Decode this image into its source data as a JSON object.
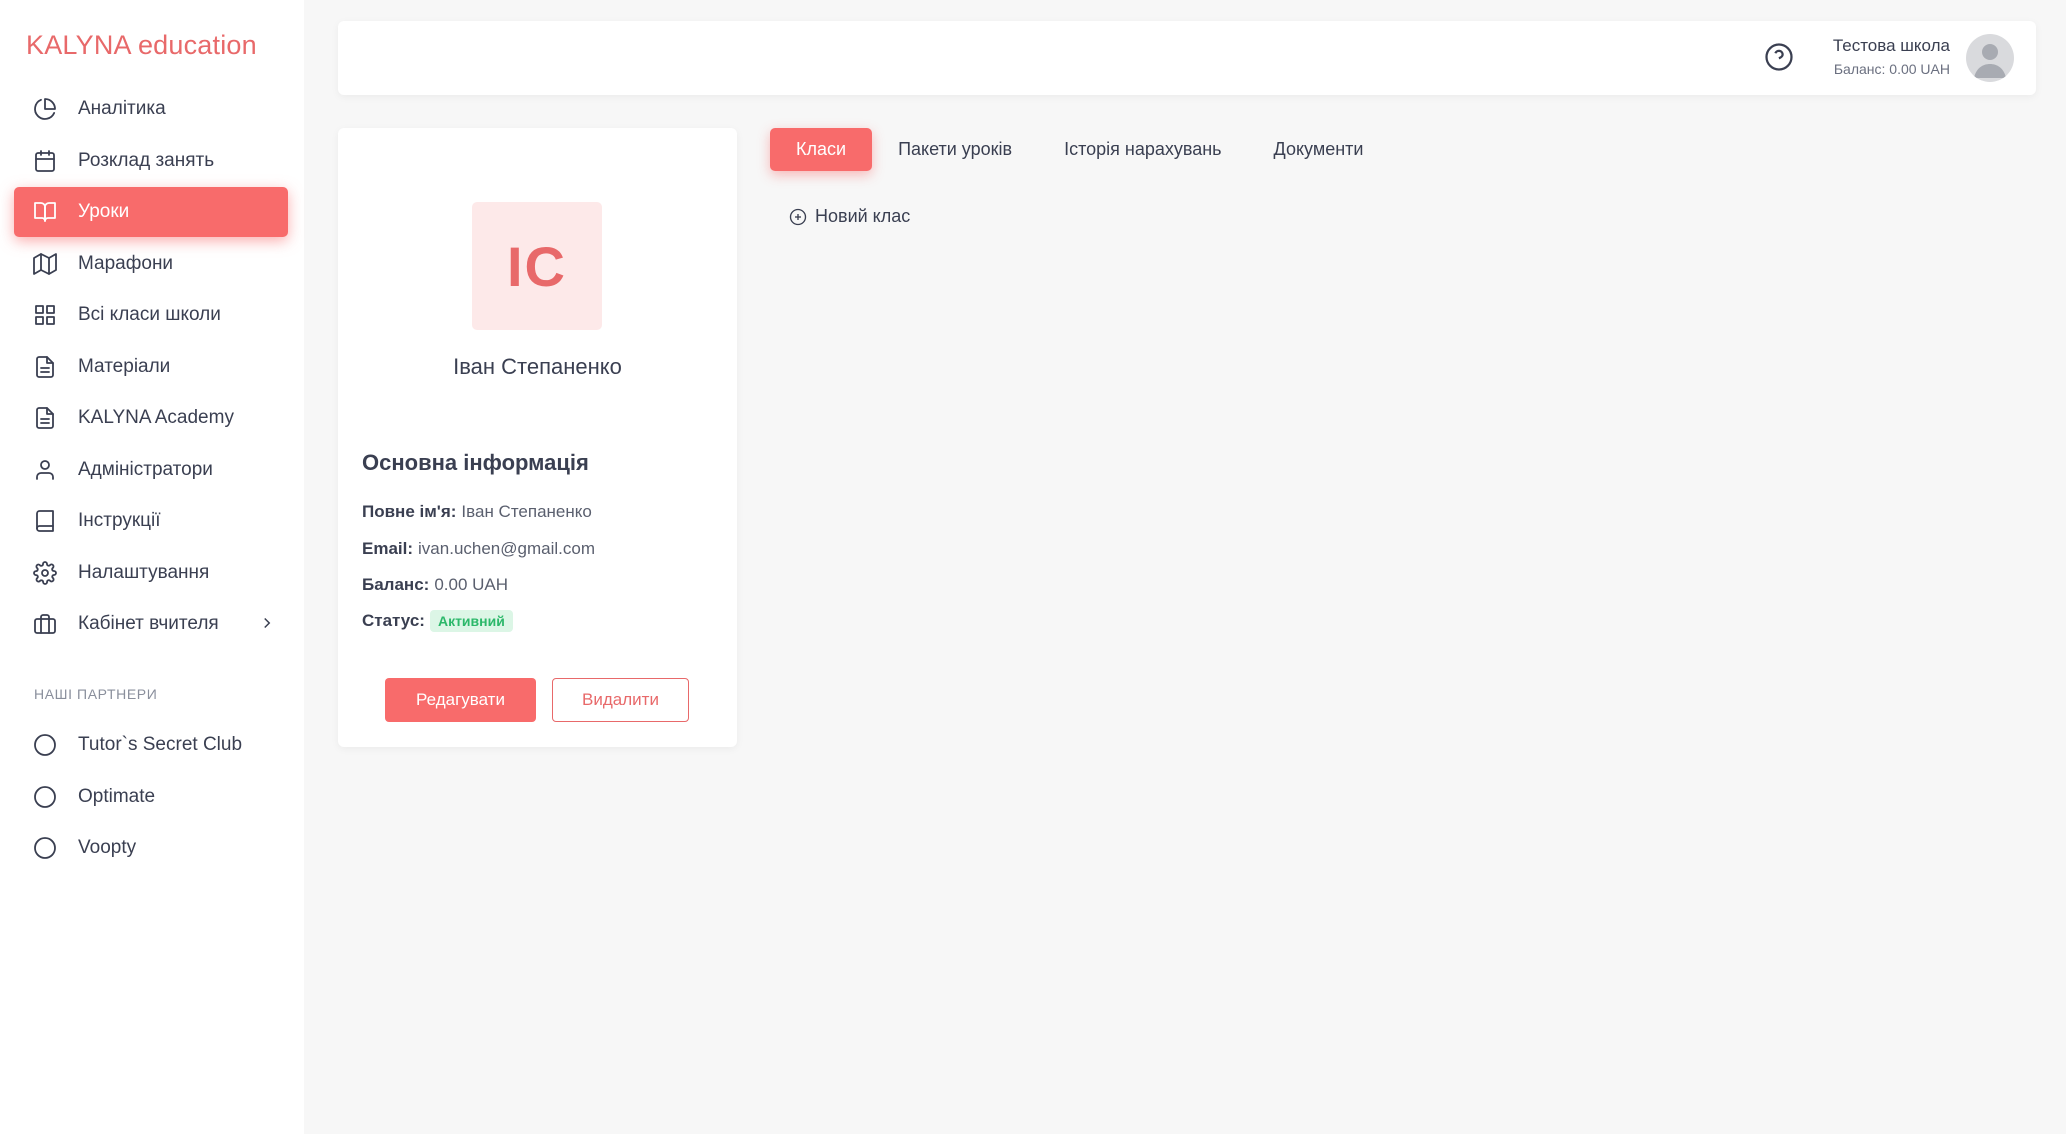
{
  "brand": {
    "logo_text": "KALYNA education",
    "accent_color": "#f86b6b"
  },
  "sidebar": {
    "items": [
      {
        "label": "Аналітика",
        "icon": "pie-chart-icon"
      },
      {
        "label": "Розклад занять",
        "icon": "calendar-icon"
      },
      {
        "label": "Уроки",
        "icon": "book-open-icon",
        "active": true
      },
      {
        "label": "Марафони",
        "icon": "map-icon"
      },
      {
        "label": "Всі класи школи",
        "icon": "grid-icon"
      },
      {
        "label": "Матеріали",
        "icon": "document-icon"
      },
      {
        "label": "KALYNA Academy",
        "icon": "document-icon"
      },
      {
        "label": "Адміністратори",
        "icon": "user-icon"
      },
      {
        "label": "Інструкції",
        "icon": "book-icon"
      },
      {
        "label": "Налаштування",
        "icon": "gear-icon"
      },
      {
        "label": "Кабінет вчителя",
        "icon": "briefcase-icon",
        "has_submenu": true
      }
    ],
    "partners_title": "НАШІ ПАРТНЕРИ",
    "partners": [
      {
        "label": "Tutor`s Secret Club",
        "icon": "circle-icon"
      },
      {
        "label": "Optimate",
        "icon": "circle-icon"
      },
      {
        "label": "Voopty",
        "icon": "circle-icon"
      }
    ]
  },
  "header": {
    "help_icon": "question-circle-icon",
    "school_name": "Тестова школа",
    "balance": "Баланс: 0.00 UAH",
    "avatar_icon": "user-avatar-icon"
  },
  "profile": {
    "initials": "ІС",
    "name": "Іван Степаненко",
    "info_title": "Основна інформація",
    "full_name_label": "Повне ім'я:",
    "full_name_value": "Іван Степаненко",
    "email_label": "Email:",
    "email_value": "ivan.uchen@gmail.com",
    "balance_label": "Баланс:",
    "balance_value": "0.00 UAH",
    "status_label": "Статус:",
    "status_value": "Активний",
    "edit_label": "Редагувати",
    "delete_label": "Видалити"
  },
  "tabs": [
    {
      "label": "Класи",
      "active": true
    },
    {
      "label": "Пакети уроків"
    },
    {
      "label": "Історія нарахувань"
    },
    {
      "label": "Документи"
    }
  ],
  "new_class_label": "Новий клас"
}
